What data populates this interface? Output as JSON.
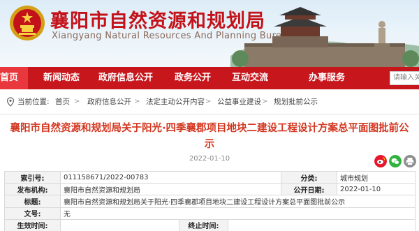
{
  "header": {
    "title": "襄阳市自然资源和规划局",
    "subtitle": "Xiangyang Natural Resources And Planning Bureau"
  },
  "nav": {
    "items": [
      {
        "label": "首页"
      },
      {
        "label": "新闻动态"
      },
      {
        "label": "政府信息公开"
      },
      {
        "label": "政务公开"
      },
      {
        "label": "互动交流"
      },
      {
        "label": "办事服务"
      }
    ],
    "search_placeholder": "请输入关"
  },
  "breadcrumb": {
    "prefix": "当前位置:",
    "items": [
      "首页",
      "政府信息公开",
      "法定主动公开内容",
      "公益事业建设",
      "规划批前公示"
    ],
    "separator": ">"
  },
  "article": {
    "title": "襄阳市自然资源和规划局关于阳光·四季襄郡项目地块二建设工程设计方案总平面图批前公示",
    "date": "2022-01-10"
  },
  "info": {
    "index_label": "索引号:",
    "index_value": "011158671/2022-00783",
    "category_label": "分类:",
    "category_value": "城市规划",
    "issuer_label": "发布机构:",
    "issuer_value": "襄阳市自然资源和规划局",
    "pubdate_label": "公开日期:",
    "pubdate_value": "2022-01-10",
    "subject_label": "标题:",
    "subject_value": "襄阳市自然资源和规划局关于阳光·四季襄郡项目地块二建设工程设计方案总平面图批前公示",
    "docno_label": "文号:",
    "docno_value": "无",
    "effective_label": "生效时间:",
    "effective_value": "",
    "end_label": "终止时间:",
    "end_value": ""
  },
  "colors": {
    "brand_red": "#c8161d",
    "title_red": "#d3361f"
  },
  "icons": [
    "national-emblem-icon",
    "location-pin-icon",
    "weibo-icon",
    "wechat-icon",
    "print-icon"
  ]
}
